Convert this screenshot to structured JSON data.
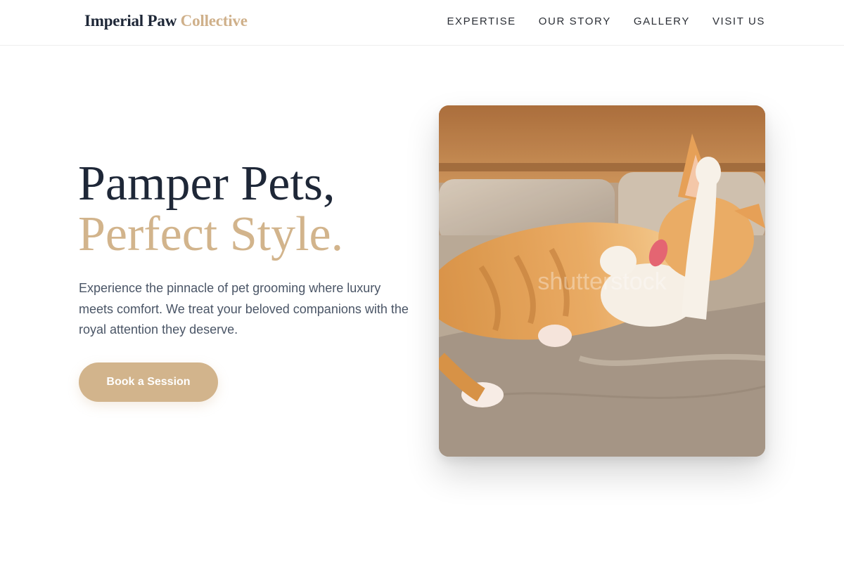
{
  "brand": {
    "name_main": "Imperial Paw",
    "name_accent": "Collective"
  },
  "nav": {
    "items": [
      {
        "label": "EXPERTISE"
      },
      {
        "label": "OUR STORY"
      },
      {
        "label": "GALLERY"
      },
      {
        "label": "VISIT US"
      }
    ]
  },
  "hero": {
    "title_line1": "Pamper Pets,",
    "title_line2": "Perfect Style.",
    "description": "Experience the pinnacle of pet grooming where luxury meets comfort. We treat your beloved companions with the royal attention they deserve.",
    "cta_label": "Book a Session",
    "image_watermark": "shutterstock"
  },
  "colors": {
    "accent": "#d2b48c",
    "heading": "#1e2737",
    "body_text": "#4a5566",
    "background": "#ffffff"
  }
}
